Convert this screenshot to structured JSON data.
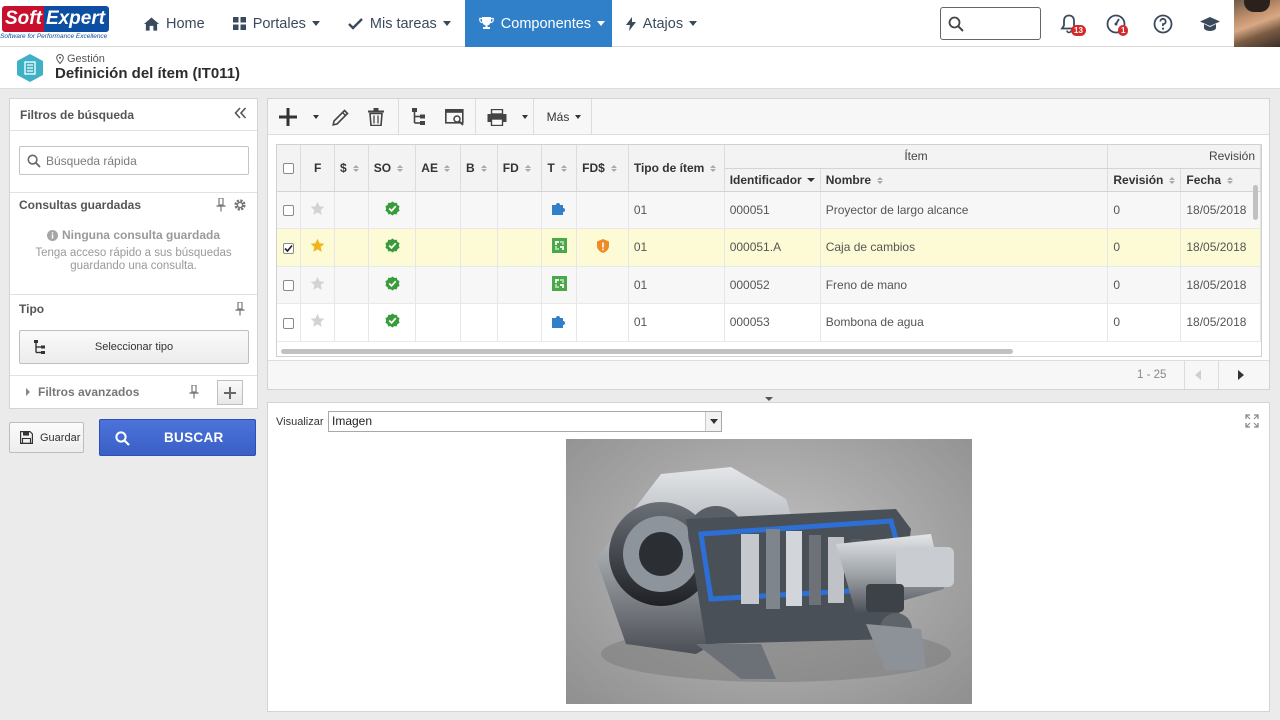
{
  "logo": {
    "line1": "Soft",
    "line2": "Expert",
    "tagline": "Software for Performance Excellence"
  },
  "nav": [
    {
      "label": "Home",
      "icon": "home-icon",
      "active": false,
      "caret": false
    },
    {
      "label": "Portales",
      "icon": "grid-icon",
      "active": false,
      "caret": true
    },
    {
      "label": "Mis tareas",
      "icon": "check-icon",
      "active": false,
      "caret": true
    },
    {
      "label": "Componentes",
      "icon": "trophy-icon",
      "active": true,
      "caret": true
    },
    {
      "label": "Atajos",
      "icon": "bolt-icon",
      "active": false,
      "caret": true
    }
  ],
  "top_icons": {
    "notifications_count": "13",
    "tasks_count": "1"
  },
  "header": {
    "breadcrumb": "Gestión",
    "title": "Definición del ítem (IT011)"
  },
  "filters": {
    "title": "Filtros de búsqueda",
    "quick_search_placeholder": "Búsqueda rápida",
    "saved_title": "Consultas guardadas",
    "saved_empty_title": "Ninguna consulta guardada",
    "saved_empty_desc": "Tenga acceso rápido a sus búsquedas guardando una consulta.",
    "type_title": "Tipo",
    "select_type_label": "Seleccionar tipo",
    "advanced_label": "Filtros avanzados",
    "save_label": "Guardar",
    "search_label": "BUSCAR"
  },
  "toolbar": {
    "more_label": "Más"
  },
  "table": {
    "group_item": "Ítem",
    "group_revision": "Revisión",
    "columns": {
      "f": "F",
      "s": "$",
      "so": "SO",
      "ae": "AE",
      "b": "B",
      "fd": "FD",
      "t": "T",
      "fds": "FD$",
      "tipo": "Tipo de ítem",
      "id": "Identificador",
      "nombre": "Nombre",
      "revision": "Revisión",
      "fecha": "Fecha"
    },
    "rows": [
      {
        "checked": false,
        "starred": false,
        "type_icon": "puzzle-blue",
        "alert": false,
        "tipo": "01",
        "id": "000051",
        "nombre": "Proyector de largo alcance",
        "revision": "0",
        "fecha": "18/05/2018"
      },
      {
        "checked": true,
        "starred": true,
        "type_icon": "puzzle-green",
        "alert": true,
        "tipo": "01",
        "id": "000051.A",
        "nombre": "Caja de cambios",
        "revision": "0",
        "fecha": "18/05/2018"
      },
      {
        "checked": false,
        "starred": false,
        "type_icon": "puzzle-green",
        "alert": false,
        "tipo": "01",
        "id": "000052",
        "nombre": "Freno de mano",
        "revision": "0",
        "fecha": "18/05/2018"
      },
      {
        "checked": false,
        "starred": false,
        "type_icon": "puzzle-blue",
        "alert": false,
        "tipo": "01",
        "id": "000053",
        "nombre": "Bombona de agua",
        "revision": "0",
        "fecha": "18/05/2018"
      }
    ],
    "pager_text": "1 - 25"
  },
  "viewer": {
    "label": "Visualizar",
    "selected": "Imagen"
  },
  "colors": {
    "accent": "#2f7fc9",
    "search_button": "#3e64cc",
    "selected_row": "#fdfbd6",
    "status_green": "#3a9b3a"
  }
}
